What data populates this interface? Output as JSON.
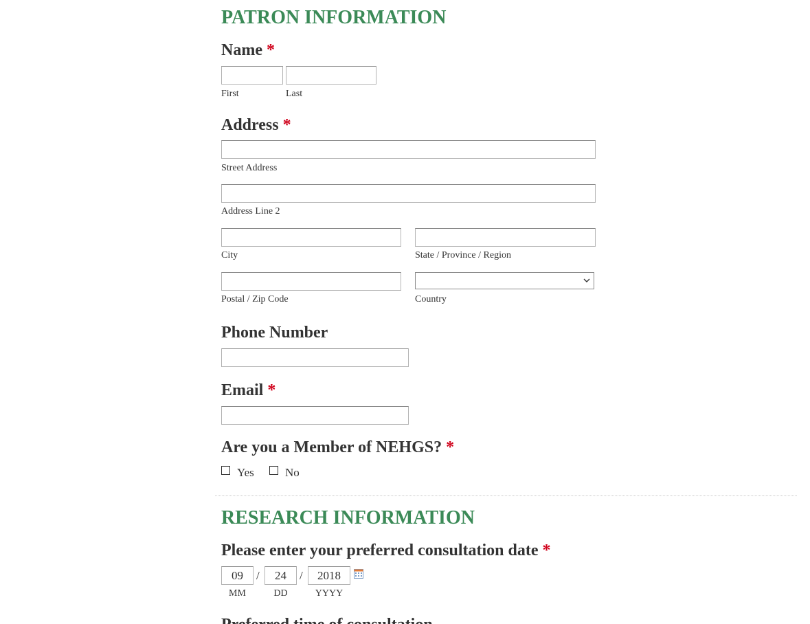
{
  "patron": {
    "title": "PATRON INFORMATION",
    "required_mark": "*",
    "name": {
      "label": "Name",
      "first_label": "First",
      "last_label": "Last",
      "first_value": "",
      "last_value": ""
    },
    "address": {
      "label": "Address",
      "street_label": "Street Address",
      "line2_label": "Address Line 2",
      "city_label": "City",
      "state_label": "State / Province / Region",
      "zip_label": "Postal / Zip Code",
      "country_label": "Country",
      "country_selected": ""
    },
    "phone": {
      "label": "Phone Number",
      "value": ""
    },
    "email": {
      "label": "Email",
      "value": ""
    },
    "member": {
      "label": "Are you a Member of NEHGS?",
      "options": [
        {
          "label": "Yes",
          "checked": false
        },
        {
          "label": "No",
          "checked": false
        }
      ]
    }
  },
  "research": {
    "title": "RESEARCH INFORMATION",
    "date": {
      "label": "Please enter your preferred consultation date",
      "month": "09",
      "day": "24",
      "year": "2018",
      "separator": "/",
      "month_label": "MM",
      "day_label": "DD",
      "year_label": "YYYY",
      "icon": "calendar-icon"
    },
    "time_label": "Preferred time of consultation"
  },
  "colors": {
    "section_title": "#3b8a57",
    "required": "#d0021b",
    "text": "#333333"
  }
}
